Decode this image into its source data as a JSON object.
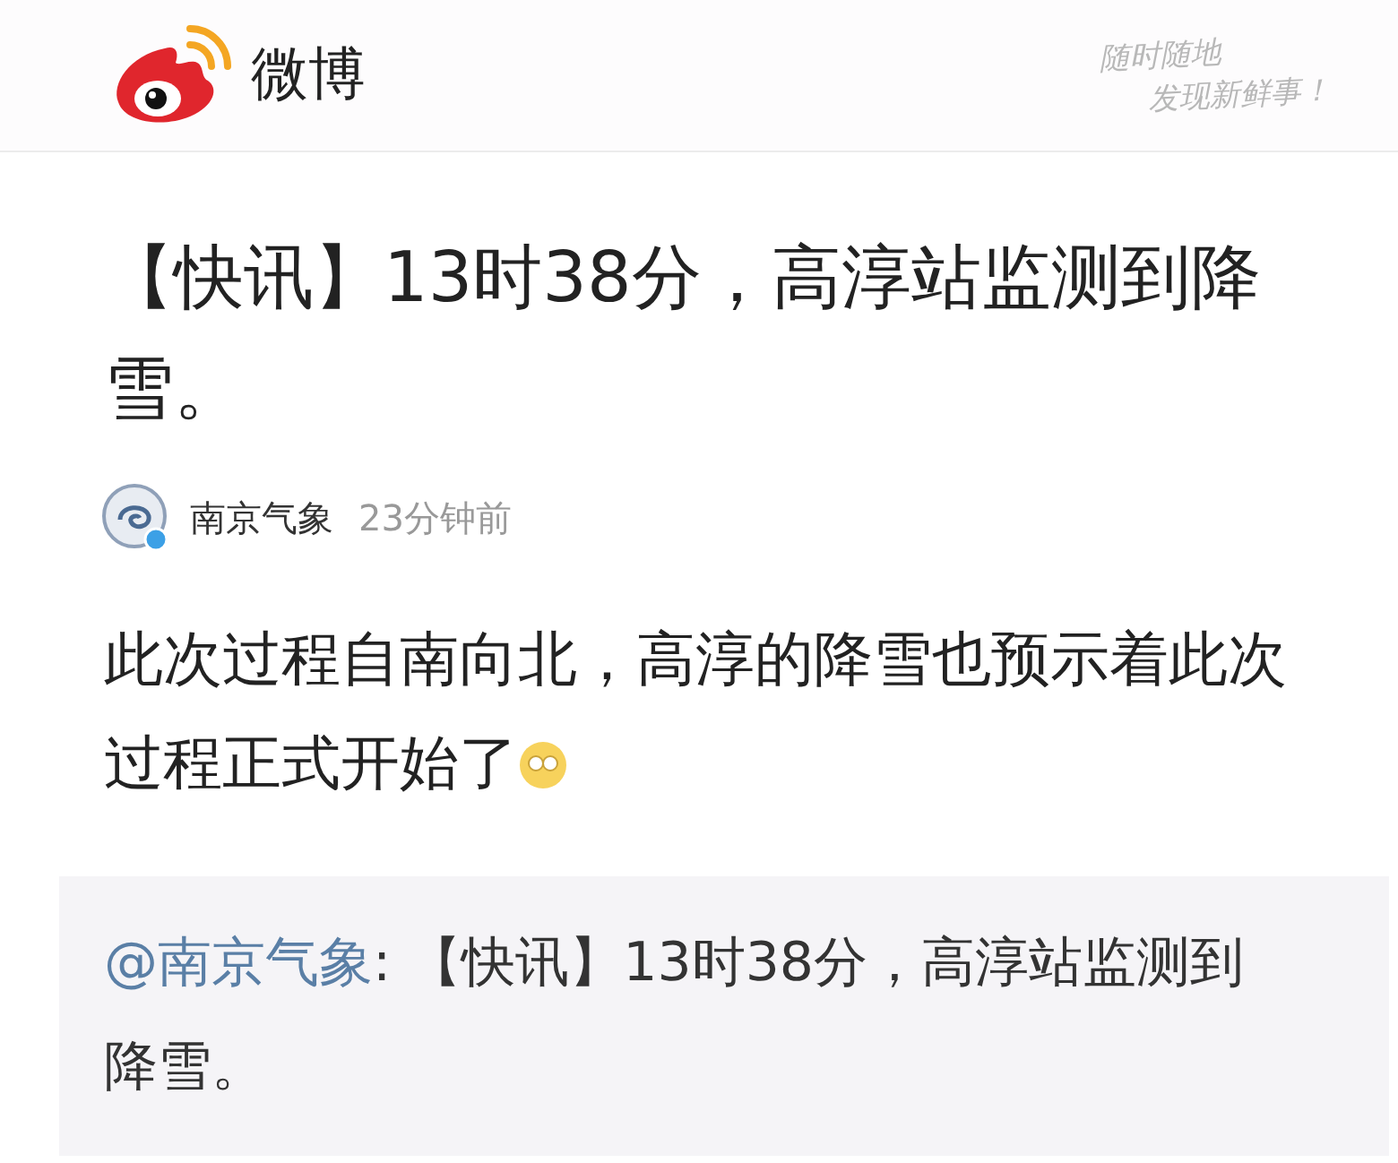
{
  "header": {
    "brand": "微博",
    "slogan": [
      "随时随地",
      "发现新鲜事！"
    ]
  },
  "post": {
    "title": "【快讯】13时38分，高淳站监测到降雪。",
    "author": "南京气象",
    "time": "23分钟前",
    "body": "此次过程自南向北，高淳的降雪也预示着此次过程正式开始了"
  },
  "repost": {
    "mention": "@南京气象",
    "text": ": 【快讯】13时38分，高淳站监测到降雪。"
  }
}
